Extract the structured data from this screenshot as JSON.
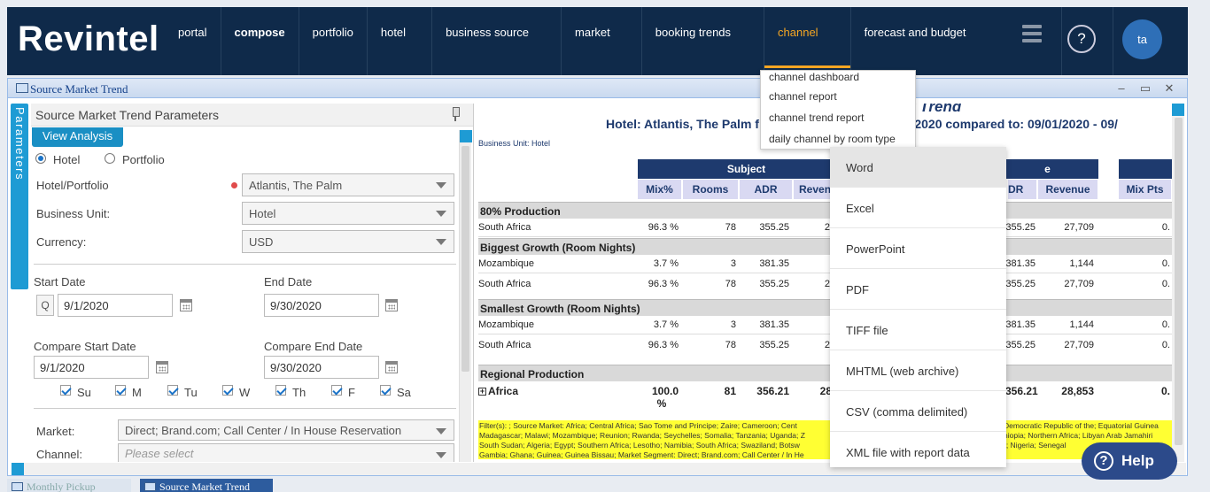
{
  "app": {
    "logo": "Revintel",
    "user_initials": "ta",
    "help_label": "?"
  },
  "nav": {
    "items": [
      {
        "label": "portal"
      },
      {
        "label": "compose"
      },
      {
        "label": "portfolio"
      },
      {
        "label": "hotel"
      },
      {
        "label": "business source"
      },
      {
        "label": "market"
      },
      {
        "label": "booking trends"
      },
      {
        "label": "channel"
      },
      {
        "label": "forecast and budget"
      }
    ],
    "active": "channel"
  },
  "channel_menu": [
    "channel dashboard",
    "channel report",
    "channel trend report",
    "daily channel by room type"
  ],
  "window": {
    "title": "Source Market Trend",
    "minimize": "–",
    "maximize": "▭",
    "close": "✕"
  },
  "params": {
    "side_tab": "Source Market Trend Parameters",
    "title": "Source Market Trend Parameters",
    "view_button": "View Analysis",
    "radio_hotel": "Hotel",
    "radio_portfolio": "Portfolio",
    "hotel_label": "Hotel/Portfolio",
    "hotel_value": "Atlantis, The Palm",
    "bu_label": "Business Unit:",
    "bu_value": "Hotel",
    "currency_label": "Currency:",
    "currency_value": "USD",
    "start_label": "Start Date",
    "start_value": "9/1/2020",
    "q_label": "Q",
    "end_label": "End Date",
    "end_value": "9/30/2020",
    "cstart_label": "Compare Start Date",
    "cstart_value": "9/1/2020",
    "cend_label": "Compare End Date",
    "cend_value": "9/30/2020",
    "days": [
      "Su",
      "M",
      "Tu",
      "W",
      "Th",
      "F",
      "Sa"
    ],
    "market_label": "Market:",
    "market_value": "Direct; Brand.com; Call Center / In House Reservation",
    "channel_label": "Channel:",
    "channel_placeholder": "Please select"
  },
  "report": {
    "title_partial": "ket Trend",
    "subtitle_left": "Hotel: Atlantis, The Palm f",
    "subtitle_right": "/30/2020 compared to: 09/01/2020 - 09/",
    "business_unit": "Business Unit: Hotel",
    "group_subject": "Subject",
    "group_compare": "e",
    "columns": [
      "Mix%",
      "Rooms",
      "ADR",
      "Reven",
      "DR",
      "Revenue",
      "Mix Pts"
    ],
    "sections": {
      "s1": "80% Production",
      "s2": "Biggest Growth (Room Nights)",
      "s3": "Smallest Growth (Room Nights)",
      "s4": "Regional Production"
    },
    "rows": [
      {
        "label": "South Africa",
        "mix": "96.3 %",
        "rooms": "78",
        "adr": "355.25",
        "rev": "2",
        "adr2": "355.25",
        "rev2": "27,709",
        "pts": "0."
      },
      {
        "label": "Mozambique",
        "mix": "3.7 %",
        "rooms": "3",
        "adr": "381.35",
        "rev": "",
        "adr2": "381.35",
        "rev2": "1,144",
        "pts": "0."
      },
      {
        "label": "South Africa",
        "mix": "96.3 %",
        "rooms": "78",
        "adr": "355.25",
        "rev": "2",
        "adr2": "355.25",
        "rev2": "27,709",
        "pts": "0."
      },
      {
        "label": "Mozambique",
        "mix": "3.7 %",
        "rooms": "3",
        "adr": "381.35",
        "rev": "",
        "adr2": "381.35",
        "rev2": "1,144",
        "pts": "0."
      },
      {
        "label": "South Africa",
        "mix": "96.3 %",
        "rooms": "78",
        "adr": "355.25",
        "rev": "2",
        "adr2": "355.25",
        "rev2": "27,709",
        "pts": "0."
      }
    ],
    "africa": {
      "label": "Africa",
      "expander": "+",
      "mix": "100.0",
      "mix_unit": "%",
      "rooms": "81",
      "adr": "356.21",
      "rev": "28",
      "adr2": "356.21",
      "rev2": "28,853",
      "pts": "0."
    },
    "filter_left": "Filter(s): ; Source Market: Africa; Central Africa; Sao Tome and Principe; Zaire; Cameroon; Cent",
    "filter_left2": "Madagascar; Malawi; Mozambique; Reunion; Rwanda; Seychelles; Somalia; Tanzania; Uganda; Z",
    "filter_left3": "South Sudan; Algeria; Egypt; Southern Africa; Lesotho; Namibia; South Africa; Swaziland; Botsw",
    "filter_left4": "Gambia; Ghana; Guinea; Guinea Bissau; Market Segment: Direct; Brand.com; Call Center / In He",
    "filter_right": "Democratic Republic of the; Equatorial Guinea",
    "filter_right2": "hiopia; Northern Africa; Libyan Arab Jamahiri",
    "filter_right3": "r; Nigeria; Senegal",
    "filter_right4": ""
  },
  "export_menu": [
    "Word",
    "Excel",
    "PowerPoint",
    "PDF",
    "TIFF file",
    "MHTML (web archive)",
    "CSV (comma delimited)",
    "XML file with report data"
  ],
  "help": {
    "label": "Help",
    "icon": "?"
  },
  "taskbar": [
    "Monthly Pickup",
    "Source Market Trend"
  ],
  "colors": {
    "nav_bg": "#0f2a4a",
    "accent": "#f5a623",
    "blue": "#1e9bd4",
    "header_navy": "#1e3a6e",
    "filter_yellow": "#ffff33"
  }
}
